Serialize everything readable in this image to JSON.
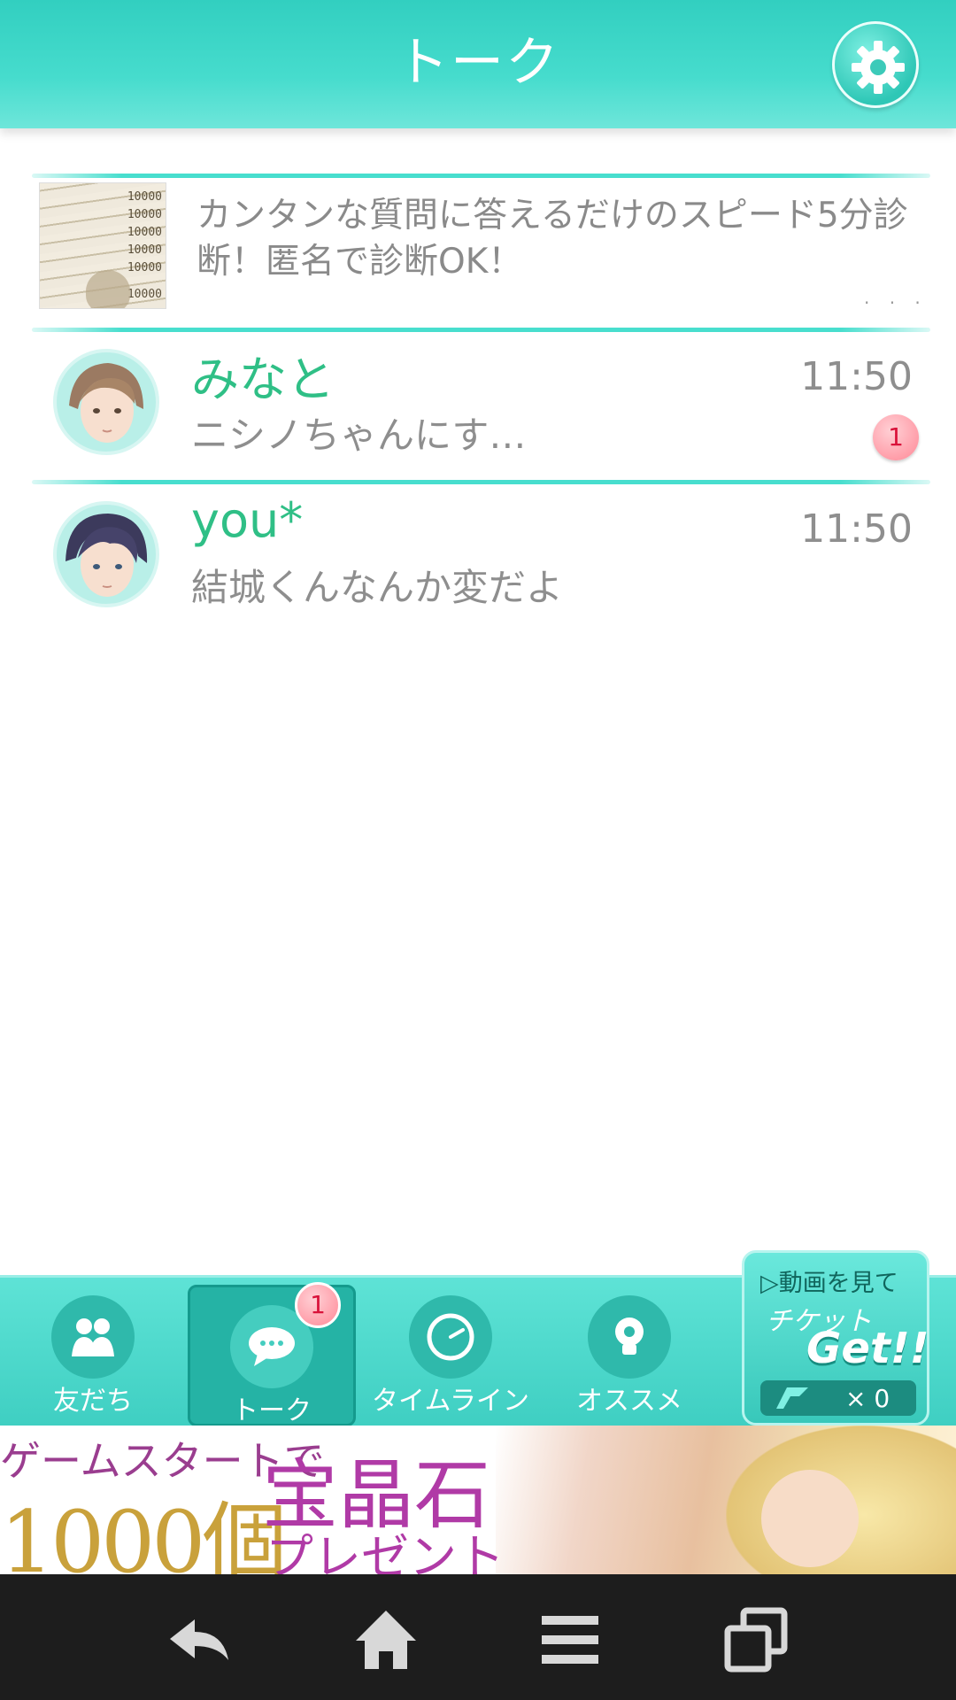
{
  "header": {
    "title": "トーク",
    "settings_icon": "gear-icon"
  },
  "ad": {
    "text": "カンタンな質問に答えるだけのスピード5分診断！匿名で診断OK！",
    "thumbnail_labels": [
      "10000",
      "10000",
      "10000",
      "10000",
      "10000",
      "10000"
    ]
  },
  "chats": [
    {
      "name": "みなと",
      "time": "11:50",
      "message": "ニシノちゃんにす…",
      "unread": "1"
    },
    {
      "name": "you*",
      "time": "11:50",
      "message": "結城くんなんか変だよ",
      "unread": ""
    }
  ],
  "bottom_nav": {
    "items": [
      {
        "label": "友だち",
        "icon": "friends-icon"
      },
      {
        "label": "トーク",
        "icon": "chat-bubble-icon",
        "badge": "1"
      },
      {
        "label": "タイムライン",
        "icon": "clock-icon"
      },
      {
        "label": "オススメ",
        "icon": "lightbulb-icon"
      }
    ],
    "active_index": 1
  },
  "ticket": {
    "line1": "動画を見て",
    "line2": "チケット",
    "get": "Get!!",
    "count": "× 0"
  },
  "banner": {
    "line1": "ゲームスタートで",
    "big": "1000個",
    "gem": "宝晶石",
    "present": "プレゼント"
  },
  "colors": {
    "accent": "#46dccd",
    "name_green": "#2fbf86",
    "badge_red": "#d9123a"
  }
}
